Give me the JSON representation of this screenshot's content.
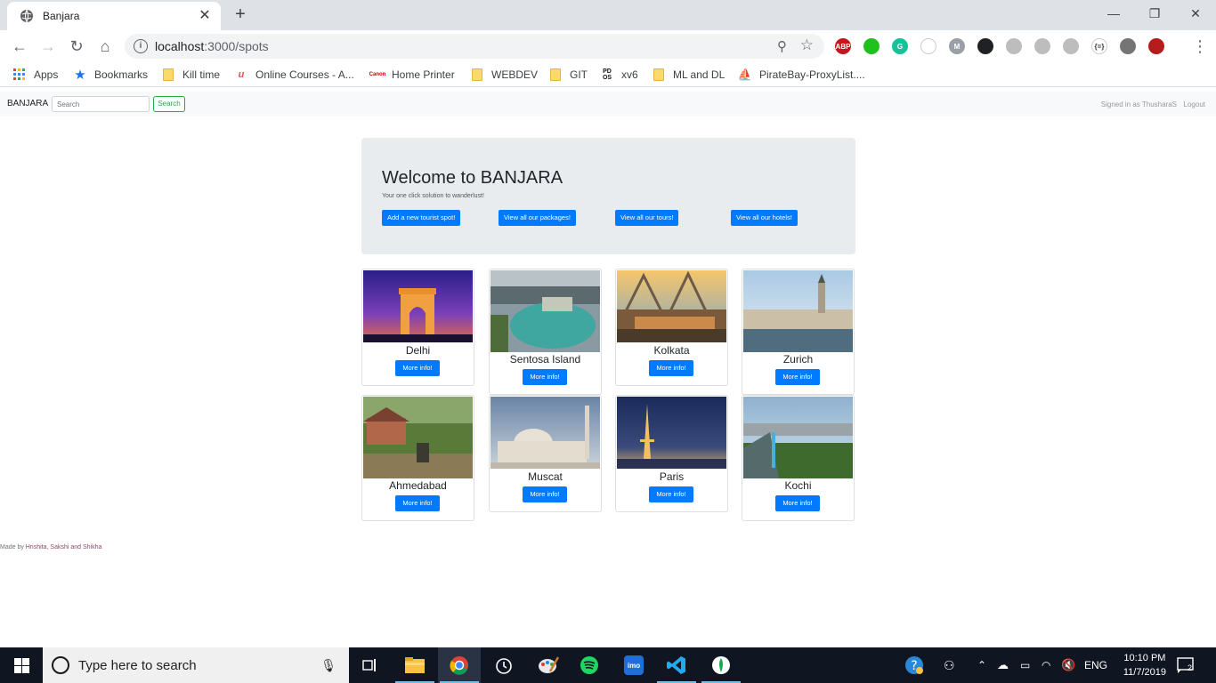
{
  "browser": {
    "tab_title": "Banjara",
    "url_host": "localhost",
    "url_path": ":3000/spots",
    "bookmarks": [
      {
        "label": "Apps"
      },
      {
        "label": "Bookmarks"
      },
      {
        "label": "Kill time"
      },
      {
        "label": "Online Courses - A..."
      },
      {
        "label": "Home Printer"
      },
      {
        "label": "WEBDEV"
      },
      {
        "label": "GIT"
      },
      {
        "label": "xv6"
      },
      {
        "label": "ML and DL"
      },
      {
        "label": "PirateBay-ProxyList...."
      }
    ],
    "extensions": [
      {
        "label": "ABP",
        "color": "#c4161c"
      },
      {
        "label": "",
        "color": "#20c020"
      },
      {
        "label": "G",
        "color": "#15c39a"
      },
      {
        "label": "",
        "color": "#ffffff"
      },
      {
        "label": "M",
        "color": "#9aa0a6"
      },
      {
        "label": "",
        "color": "#202124"
      },
      {
        "label": "",
        "color": "#bdbdbd"
      },
      {
        "label": "",
        "color": "#bdbdbd"
      },
      {
        "label": "",
        "color": "#bdbdbd"
      },
      {
        "label": "{=}",
        "color": "#ffffff"
      },
      {
        "label": "",
        "color": "#757575"
      },
      {
        "label": "",
        "color": "#b71c1c"
      }
    ]
  },
  "navbar": {
    "brand": "BANJARA",
    "search_placeholder": "Search",
    "search_button": "Search",
    "signed_in": "Signed in as ThusharaS",
    "logout": "Logout"
  },
  "jumbotron": {
    "heading": "Welcome to BANJARA",
    "lead": "Your one click solution to wanderlust!",
    "buttons": [
      "Add a new tourist spot!",
      "View all our packages!",
      "View all our tours!",
      "View all our hotels!"
    ]
  },
  "spots": [
    {
      "name": "Delhi",
      "button": "More info!"
    },
    {
      "name": "Sentosa Island",
      "button": "More info!"
    },
    {
      "name": "Kolkata",
      "button": "More info!"
    },
    {
      "name": "Zurich",
      "button": "More info!"
    },
    {
      "name": "Ahmedabad",
      "button": "More info!"
    },
    {
      "name": "Muscat",
      "button": "More info!"
    },
    {
      "name": "Paris",
      "button": "More info!"
    },
    {
      "name": "Kochi",
      "button": "More info!"
    }
  ],
  "footer": {
    "prefix": "Made by ",
    "names": "Hrishita, Sakshi and Shikha"
  },
  "taskbar": {
    "search_text": "Type here to search",
    "language": "ENG",
    "time": "10:10 PM",
    "date": "11/7/2019",
    "notification_count": "2"
  },
  "colors": {
    "primary": "#007bff",
    "success": "#28a745",
    "jumbotron_bg": "#e9ecef"
  }
}
